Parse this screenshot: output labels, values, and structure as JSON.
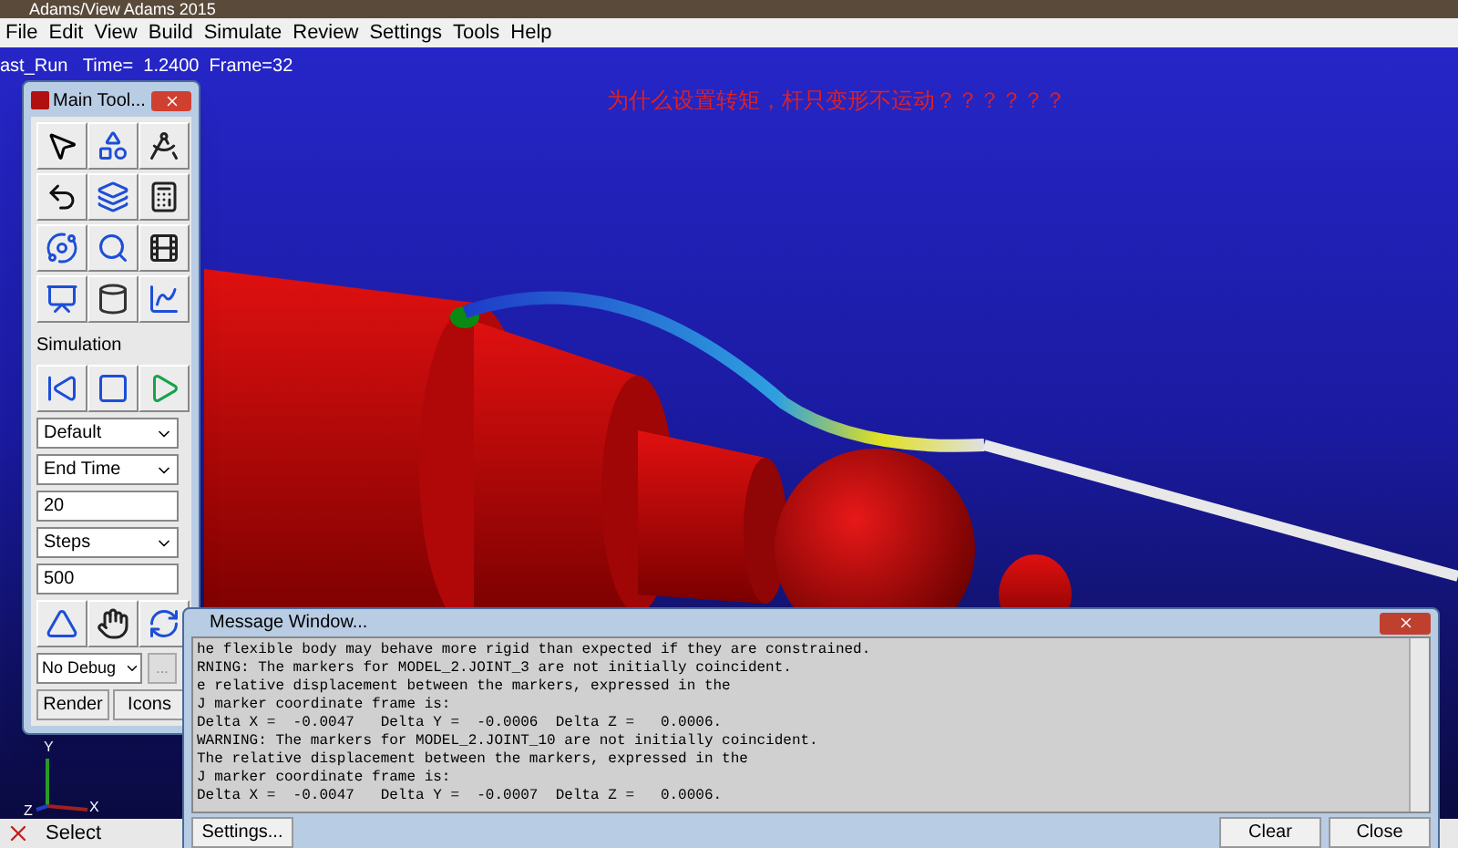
{
  "window": {
    "title": "Adams/View Adams 2015"
  },
  "menu": [
    "File",
    "Edit",
    "View",
    "Build",
    "Simulate",
    "Review",
    "Settings",
    "Tools",
    "Help"
  ],
  "viewport": {
    "run_info": "ast_Run   Time=  1.2400  Frame=32",
    "annotation": "为什么设置转矩，杆只变形不运动？？？？？？",
    "axes": {
      "y": "Y",
      "x": "X",
      "z": "Z"
    }
  },
  "toolbox": {
    "title": "Main Tool...",
    "section": "Simulation",
    "settings": [
      {
        "kind": "dropdown",
        "value": "Default"
      },
      {
        "kind": "dropdown",
        "value": "End Time"
      },
      {
        "kind": "input",
        "value": "20"
      },
      {
        "kind": "dropdown",
        "value": "Steps"
      },
      {
        "kind": "input",
        "value": "500"
      }
    ],
    "debug": "No Debug",
    "more": "...",
    "buttons": [
      "Render",
      "Icons"
    ]
  },
  "message_window": {
    "title": "Message Window...",
    "lines": [
      "he flexible body may behave more rigid than expected if they are constrained.",
      "RNING: The markers for MODEL_2.JOINT_3 are not initially coincident.",
      "e relative displacement between the markers, expressed in the",
      "J marker coordinate frame is:",
      "Delta X =  -0.0047   Delta Y =  -0.0006  Delta Z =   0.0006.",
      "WARNING: The markers for MODEL_2.JOINT_10 are not initially coincident.",
      "The relative displacement between the markers, expressed in the",
      "J marker coordinate frame is:",
      "Delta X =  -0.0047   Delta Y =  -0.0007  Delta Z =   0.0006."
    ],
    "buttons": [
      "Settings...",
      "Clear",
      "Close"
    ]
  },
  "status_bar": {
    "mode": "Select"
  }
}
